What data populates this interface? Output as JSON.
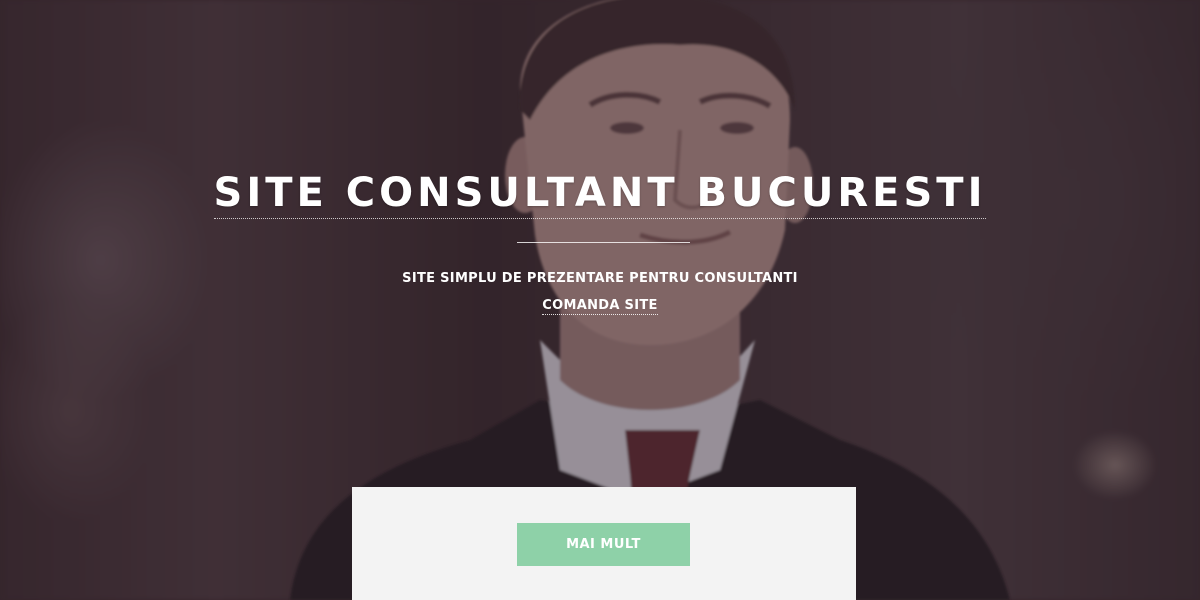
{
  "hero": {
    "title": "SITE CONSULTANT BUCURESTI",
    "subtitle": "SITE SIMPLU DE PREZENTARE PENTRU CONSULTANTI",
    "cta_link": "COMANDA SITE"
  },
  "panel": {
    "button_label": "MAI MULT"
  },
  "colors": {
    "button": "#8ed1a8",
    "panel": "#f3f3f3",
    "overlay": "#2e1e26",
    "text": "#ffffff"
  }
}
